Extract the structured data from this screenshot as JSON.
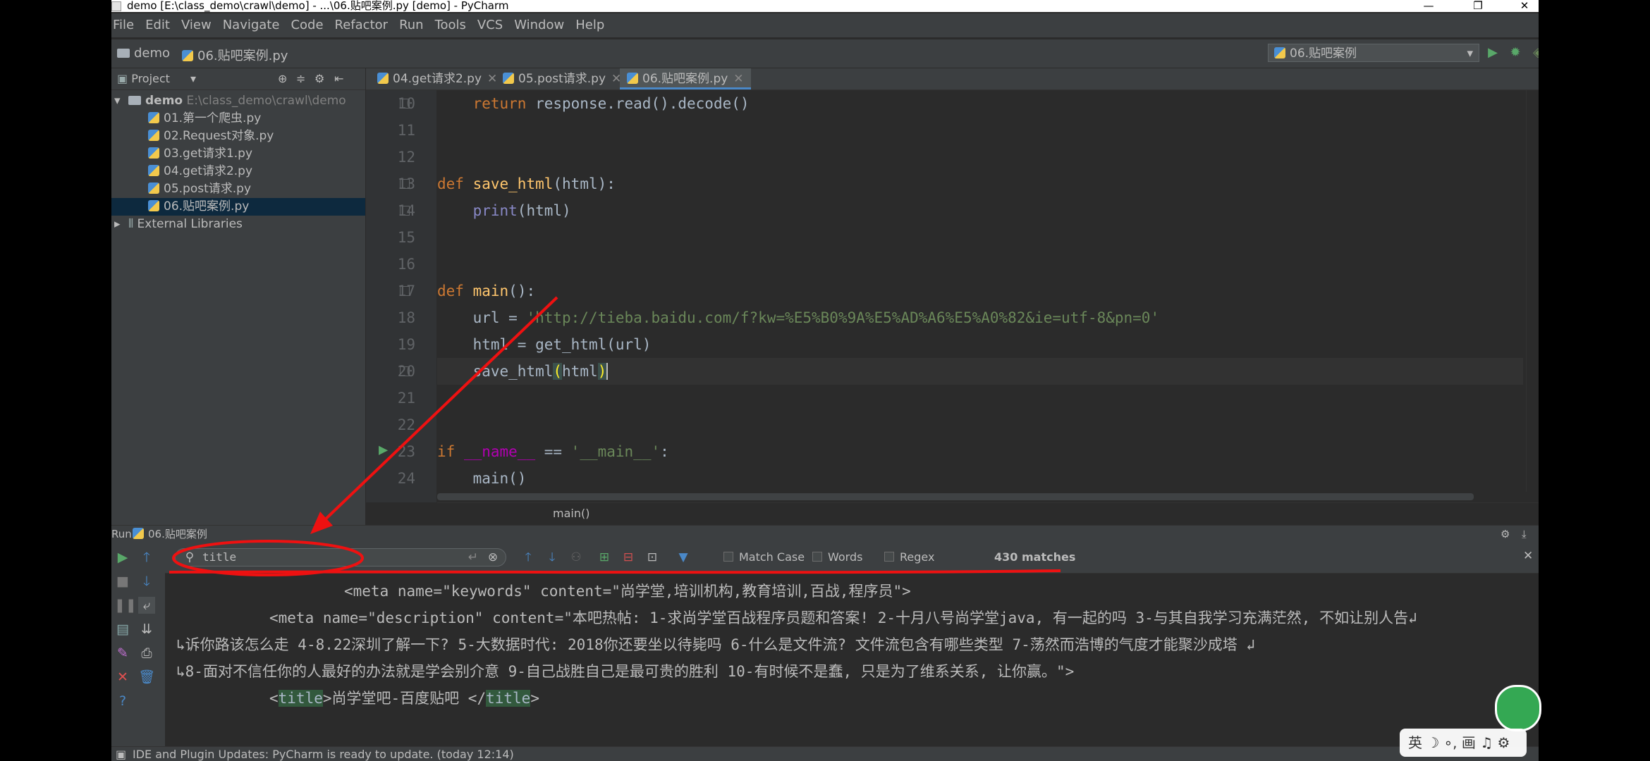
{
  "window": {
    "title": "demo [E:\\class_demo\\crawl\\demo] - ...\\06.贴吧案例.py [demo] - PyCharm",
    "controls": [
      "—",
      "❐",
      "✕"
    ]
  },
  "menu": [
    "File",
    "Edit",
    "View",
    "Navigate",
    "Code",
    "Refactor",
    "Run",
    "Tools",
    "VCS",
    "Window",
    "Help"
  ],
  "navbar": {
    "project": "demo",
    "file": "06.贴吧案例.py",
    "run_config": "06.贴吧案例"
  },
  "project_panel": {
    "label": "Project",
    "root_name": "demo",
    "root_path": "E:\\class_demo\\crawl\\demo",
    "files": [
      "01.第一个爬虫.py",
      "02.Request对象.py",
      "03.get请求1.py",
      "04.get请求2.py",
      "05.post请求.py",
      "06.贴吧案例.py"
    ],
    "external": "External Libraries"
  },
  "editor_tabs": [
    "04.get请求2.py",
    "05.post请求.py",
    "06.贴吧案例.py"
  ],
  "code": {
    "line_numbers": [
      "10",
      "11",
      "12",
      "13",
      "14",
      "15",
      "16",
      "17",
      "18",
      "19",
      "20",
      "21",
      "22",
      "23",
      "24"
    ],
    "l10_kw": "return",
    "l10_rest": " response.read().decode()",
    "l13_kw": "def",
    "l13_fn": "save_html",
    "l13_rest": "(html):",
    "l14_bi": "print",
    "l14_rest": "(html)",
    "l17_kw": "def",
    "l17_fn": "main",
    "l17_rest": "():",
    "l18_a": "url = ",
    "l18_str": "'http://tieba.baidu.com/f?kw=%E5%B0%9A%E5%AD%A6%E5%A0%82&ie=utf-8&pn=0'",
    "l19": "html = get_html(url)",
    "l20_a": "save_html",
    "l20_open": "(",
    "l20_mid": "html",
    "l20_close": ")",
    "l23_kw": "if",
    "l23_magic": " __name__",
    "l23_eq": " == ",
    "l23_str": "'__main__'",
    "l23_colon": ":",
    "l24": "main()"
  },
  "breadcrumb": "main()",
  "run_panel": {
    "title": "Run",
    "config": "06.贴吧案例",
    "search_value": "title",
    "match_case": "Match Case",
    "words": "Words",
    "regex": "Regex",
    "matches": "430 matches"
  },
  "console": {
    "l1": "<meta name=\"keywords\" content=\"尚学堂,培训机构,教育培训,百战,程序员\">",
    "l2": "<meta name=\"description\" content=\"本吧热帖: 1-求尚学堂百战程序员题和答案! 2-十月八号尚学堂java, 有一起的吗 3-与其自我学习充满茫然, 不如让别人告",
    "l3": "诉你路该怎么走 4-8.22深圳了解一下? 5-大数据时代: 2018你还要坐以待毙吗 6-什么是文件流? 文件流包含有哪些类型 7-荡然而浩博的气度才能聚沙成塔 ",
    "l4": "8-面对不信任你的人最好的办法就是学会别介意 9-自己战胜自己是最可贵的胜利 10-有时候不是蠢, 只是为了维系关系, 让你赢。\">",
    "l5_open": "<",
    "l5_tag1": "title",
    "l5_text": ">尚学堂吧-百度贴吧 </",
    "l5_tag2": "title",
    "l5_close": ">",
    "wrap_glyph": "↲",
    "wrap_start": "↳"
  },
  "status": "IDE and Plugin Updates: PyCharm is ready to update. (today 12:14)",
  "ime": "英 ☽ ∘, 画 ♫ ⚙",
  "colors": {
    "annotation": "#ee1111",
    "keyword": "#cc7832",
    "function": "#ffc66d",
    "string": "#6a8759",
    "search_hit": "#32593d"
  }
}
